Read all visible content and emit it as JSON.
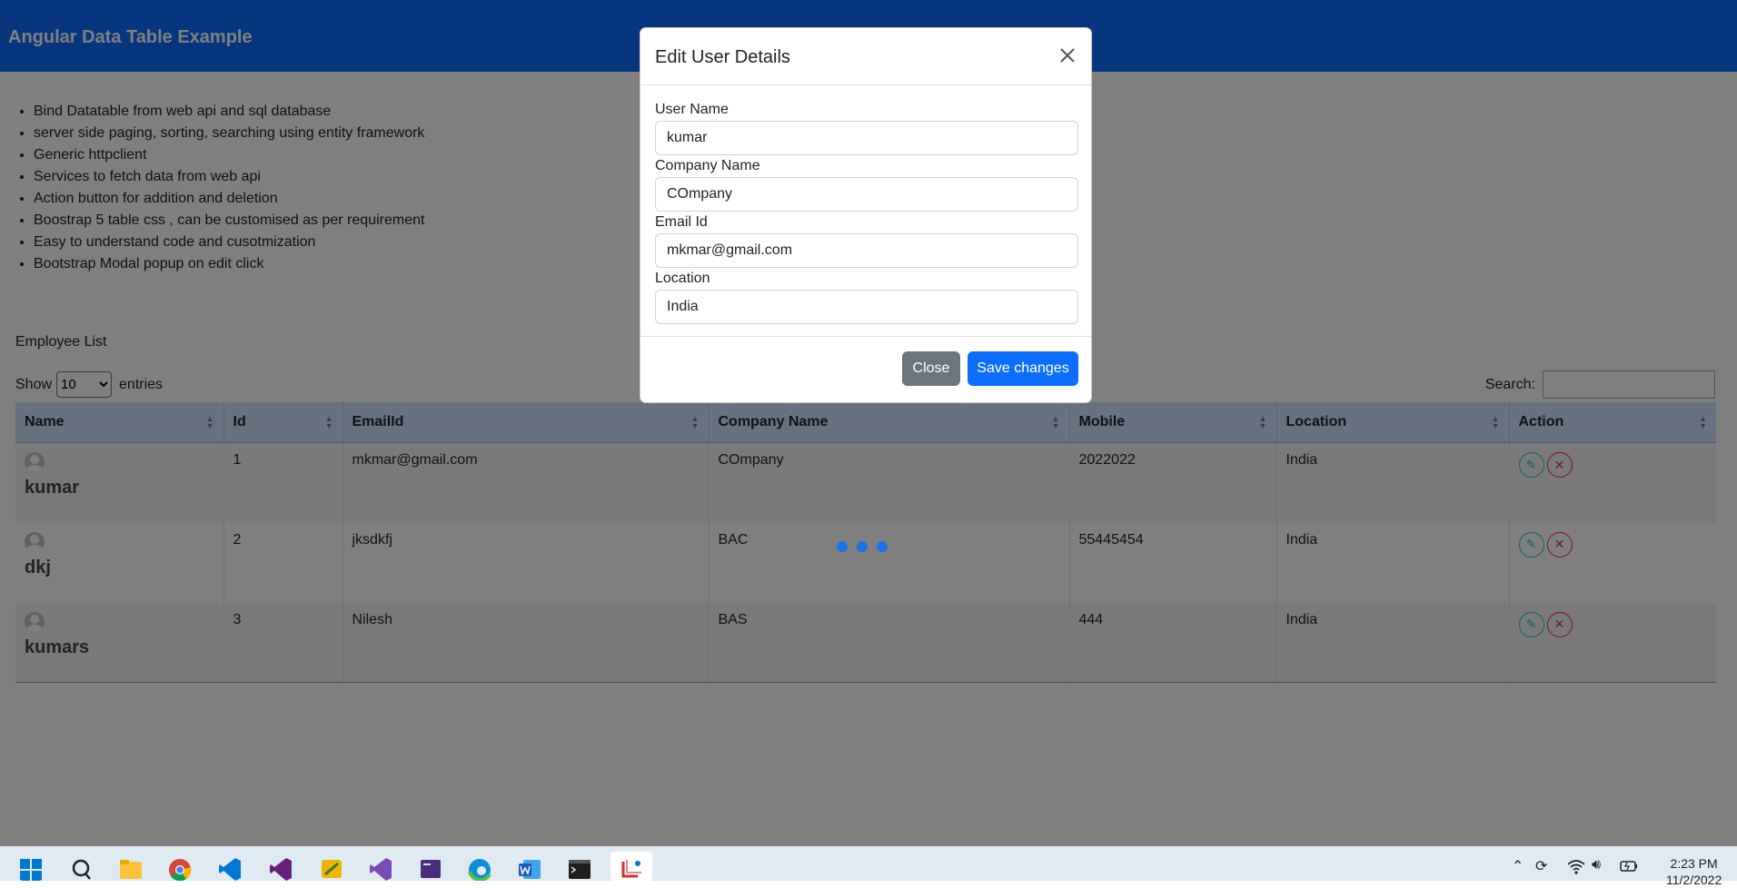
{
  "navbar": {
    "brand": "Angular Data Table Example"
  },
  "features": [
    "Bind Datatable from web api and sql database",
    "server side paging, sorting, searching using entity framework",
    "Generic httpclient",
    "Services to fetch data from web api",
    "Action button for addition and deletion",
    "Boostrap 5 table css , can be customised as per requirement",
    "Easy to understand code and cusotmization",
    "Bootstrap Modal popup on edit click"
  ],
  "employee_list": {
    "title": "Employee List",
    "show_label": "Show",
    "entries_value": "10",
    "entries_label": "entries",
    "search_label": "Search:",
    "search_value": "",
    "columns": [
      "Name",
      "Id",
      "EmailId",
      "Company Name",
      "Mobile",
      "Location",
      "Action"
    ],
    "rows": [
      {
        "name": "kumar",
        "id": "1",
        "email": "mkmar@gmail.com",
        "company": "COmpany",
        "mobile": "2022022",
        "location": "India"
      },
      {
        "name": "dkj",
        "id": "2",
        "email": "jksdkfj",
        "company": "BAC",
        "mobile": "55445454",
        "location": "India"
      },
      {
        "name": "kumars",
        "id": "3",
        "email": "Nilesh",
        "company": "BAS",
        "mobile": "444",
        "location": "India"
      }
    ]
  },
  "modal": {
    "title": "Edit User Details",
    "fields": [
      {
        "label": "User Name",
        "value": "kumar"
      },
      {
        "label": "Company Name",
        "value": "COmpany"
      },
      {
        "label": "Email Id",
        "value": "mkmar@gmail.com"
      },
      {
        "label": "Location",
        "value": "India"
      }
    ],
    "close_label": "Close",
    "save_label": "Save changes"
  },
  "taskbar": {
    "clock_time": "2:23 PM",
    "clock_date": "11/2/2022"
  },
  "colors": {
    "navbar": "#0d6efd",
    "table_header": "#cfe2ff",
    "primary": "#0d6efd",
    "secondary": "#6c757d",
    "edit_icon": "#0dcaf0",
    "delete_icon": "#dc3545"
  }
}
